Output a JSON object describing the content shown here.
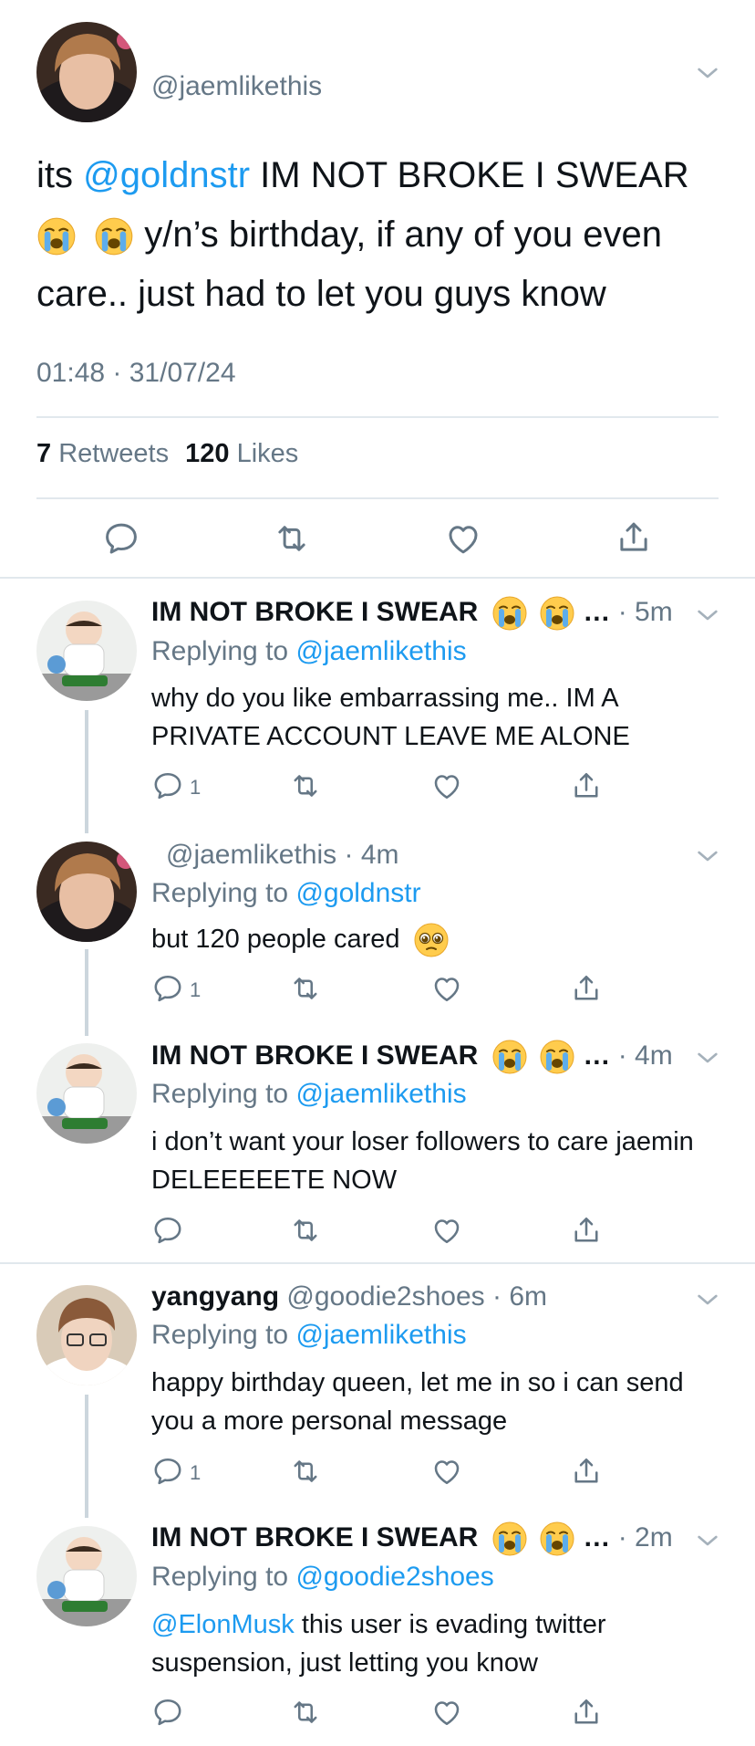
{
  "main_tweet": {
    "handle": "@jaemlikethis",
    "text_1": "its ",
    "mention": "@goldnstr",
    "text_2": " IM NOT BROKE I SWEAR ",
    "text_3": " y/n’s birthday, if any of you even care.. just had to let you guys know",
    "timestamp": "01:48 · 31/07/24",
    "retweets_count": "7",
    "retweets_label": "Retweets",
    "likes_count": "120",
    "likes_label": "Likes"
  },
  "replies": [
    {
      "name": "IM NOT BROKE I SWEAR",
      "ellipsis": "…",
      "time": "· 5m",
      "replying_label": "Replying to",
      "replying_to": "@jaemlikethis",
      "text": "why do you like embarrassing me.. IM A PRIVATE ACCOUNT LEAVE ME ALONE",
      "reply_count": "1"
    },
    {
      "handle": "@jaemlikethis",
      "time": "· 4m",
      "replying_label": "Replying to",
      "replying_to": "@goldnstr",
      "text": "but 120 people cared",
      "reply_count": "1"
    },
    {
      "name": "IM NOT BROKE I SWEAR",
      "ellipsis": "…",
      "time": "· 4m",
      "replying_label": "Replying to",
      "replying_to": "@jaemlikethis",
      "text": "i don’t want your loser followers to care jaemin DELEEEEETE NOW"
    },
    {
      "name": "yangyang",
      "handle": "@goodie2shoes",
      "time": "· 6m",
      "replying_label": "Replying to",
      "replying_to": "@jaemlikethis",
      "text": "happy birthday queen, let me in so i can send you a more personal message",
      "reply_count": "1"
    },
    {
      "name": "IM NOT BROKE I SWEAR",
      "ellipsis": "…",
      "time": "· 2m",
      "replying_label": "Replying to",
      "replying_to": "@goodie2shoes",
      "mention": "@ElonMusk",
      "text": " this user is evading twitter suspension, just letting you know"
    }
  ],
  "icons": [
    "reply-icon",
    "retweet-icon",
    "like-icon",
    "share-icon",
    "chevron-down-icon",
    "crying-emoji",
    "pleading-emoji"
  ],
  "colors": {
    "link": "#1d9bf0",
    "muted": "#657786",
    "divider": "#e1e8ed",
    "thread": "#ccd6dd"
  }
}
